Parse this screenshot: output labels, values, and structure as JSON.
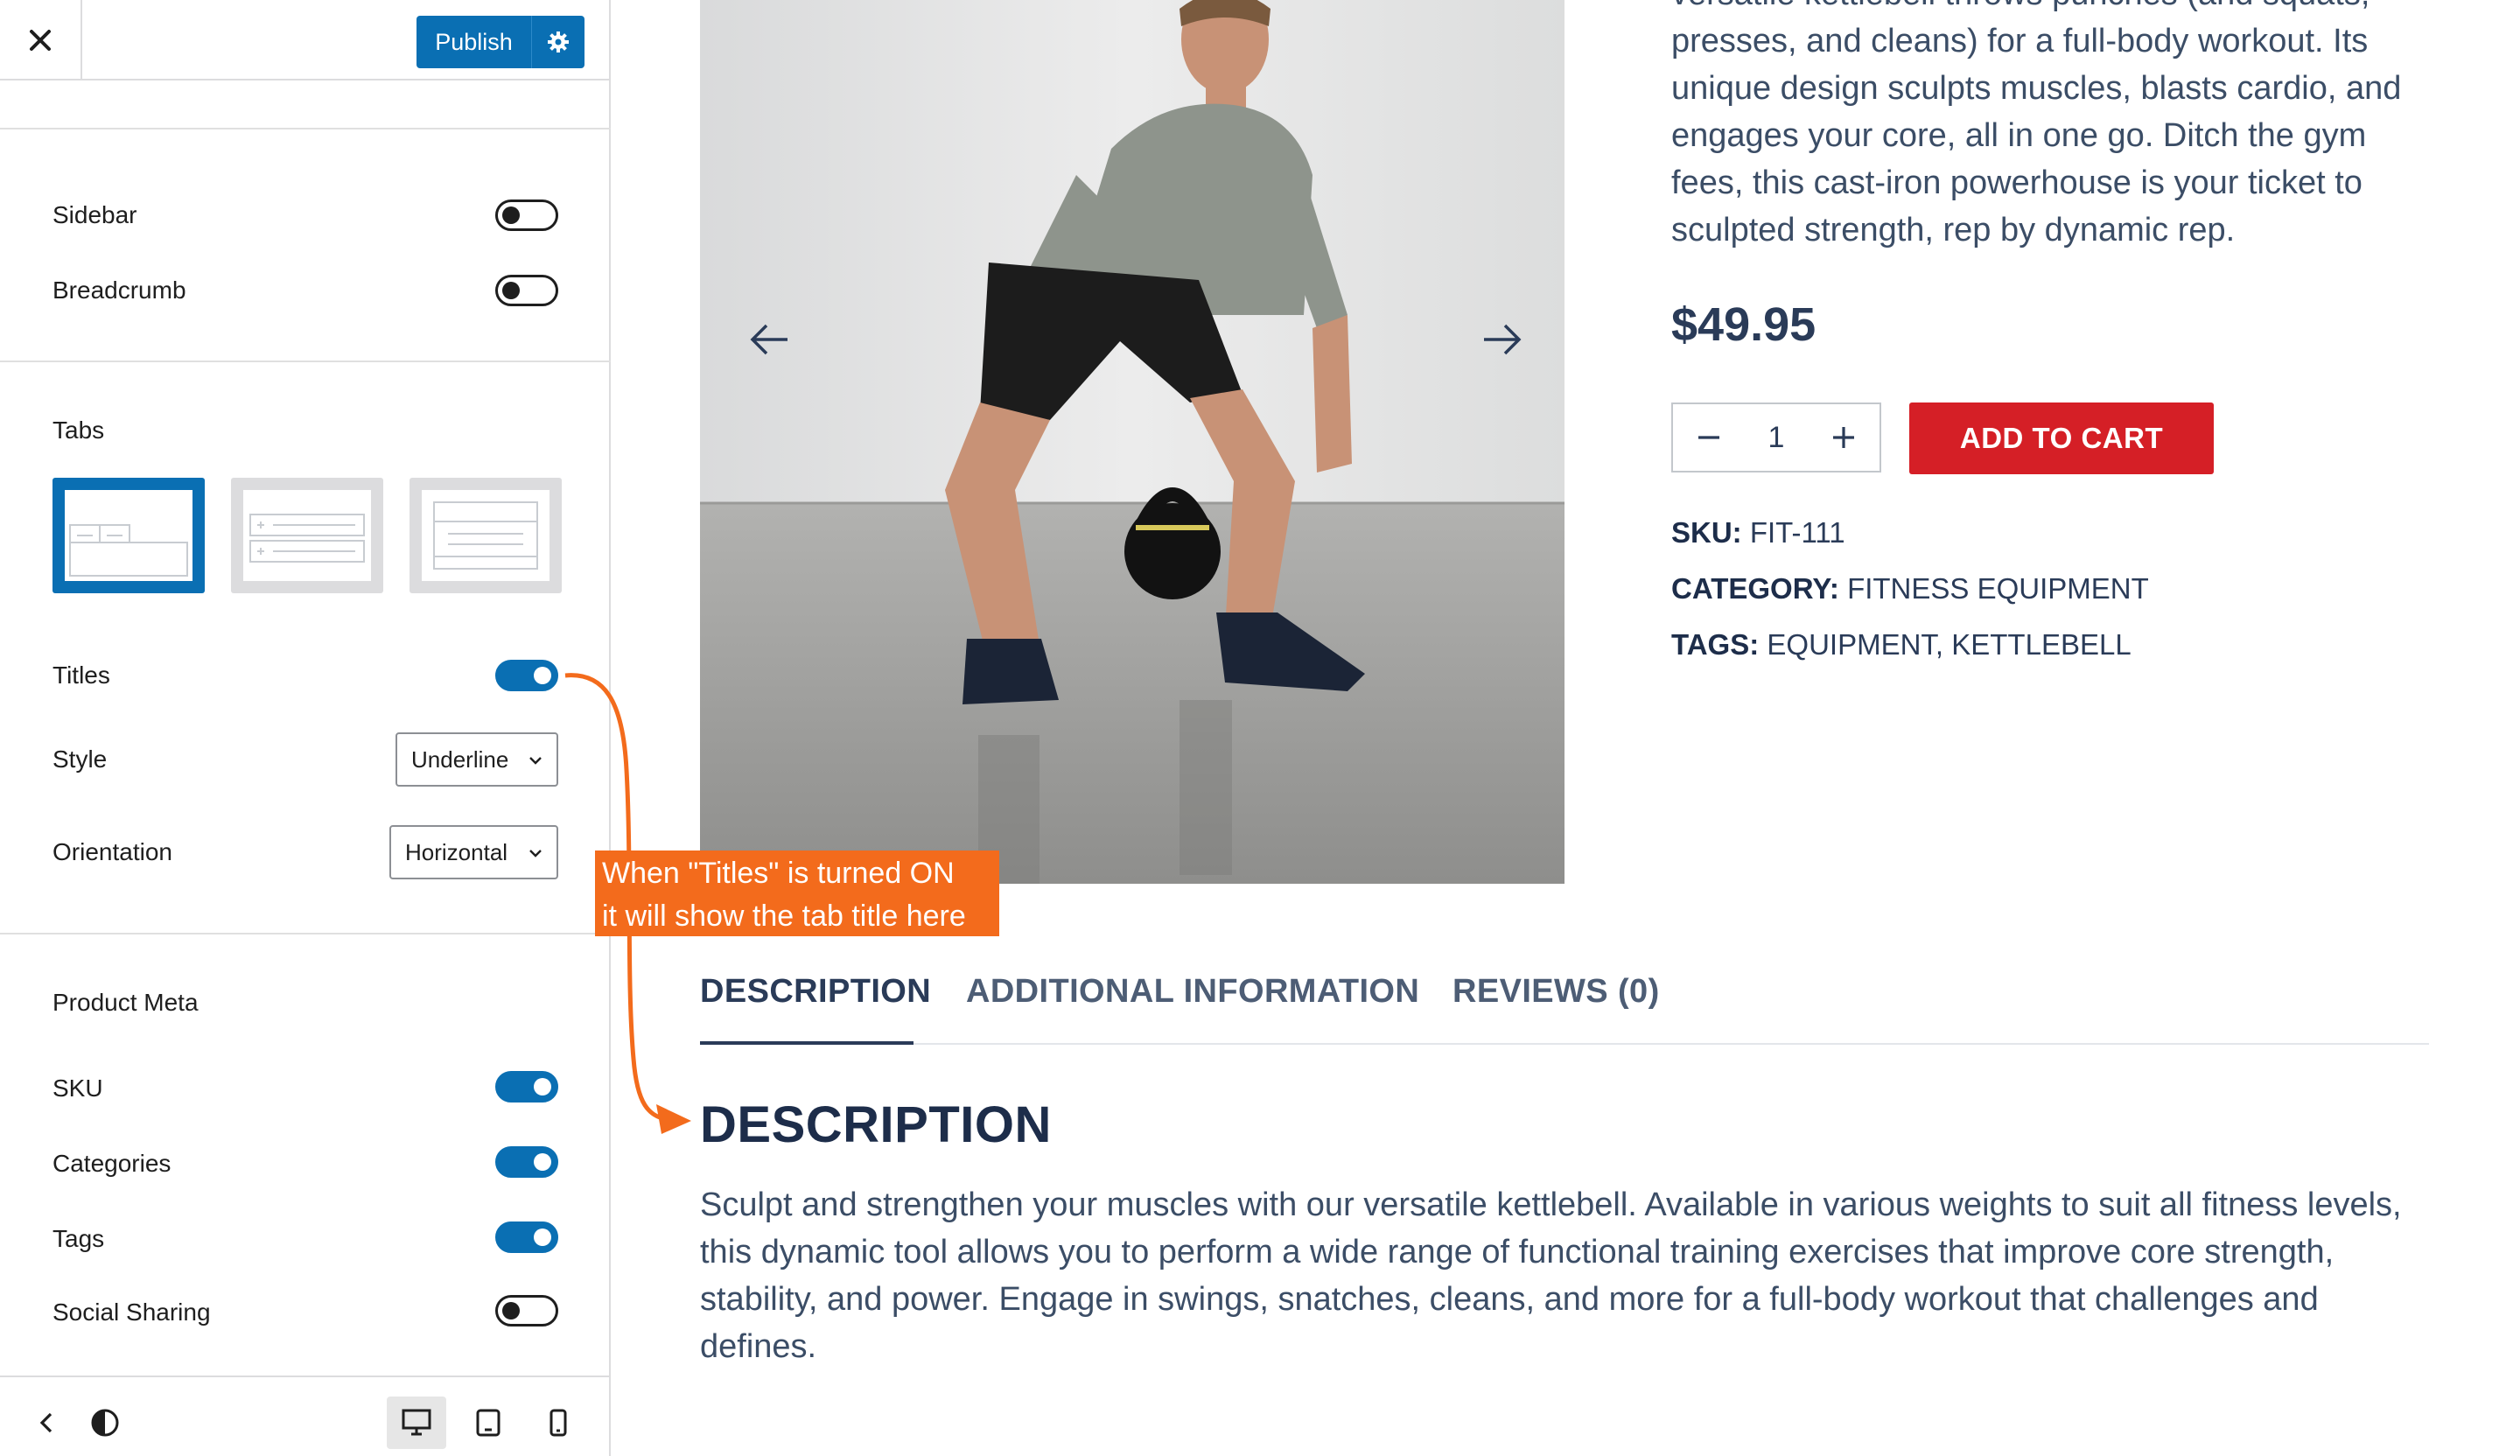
{
  "sidebar": {
    "publish_label": "Publish",
    "rows": {
      "sidebar_label": "Sidebar",
      "breadcrumb_label": "Breadcrumb",
      "titles_label": "Titles",
      "style_label": "Style",
      "orientation_label": "Orientation",
      "sku_label": "SKU",
      "categories_label": "Categories",
      "tags_label": "Tags",
      "social_label": "Social Sharing"
    },
    "toggles": {
      "sidebar": false,
      "breadcrumb": false,
      "titles": true,
      "sku": true,
      "categories": true,
      "tags": true,
      "social_sharing": false
    },
    "sections": {
      "tabs_title": "Tabs",
      "product_meta_title": "Product Meta"
    },
    "style_value": "Underline",
    "orientation_value": "Horizontal",
    "tab_layouts": [
      "horizontal",
      "accordion",
      "list"
    ],
    "selected_layout": "horizontal",
    "bottom_icons": [
      "chevron-left-icon",
      "contrast-icon",
      "desktop-icon",
      "tablet-icon",
      "mobile-icon"
    ],
    "active_device": "desktop"
  },
  "product": {
    "short_description": "versatile kettlebell throws punches (and squats, presses, and cleans) for a full-body workout. Its unique design sculpts muscles, blasts cardio, and engages your core, all in one go. Ditch the gym fees, this cast-iron powerhouse is your ticket to sculpted strength, rep by dynamic rep.",
    "price": "$49.95",
    "quantity": "1",
    "add_to_cart": "ADD TO CART",
    "meta": {
      "sku_label": "SKU:",
      "sku_value": "FIT-111",
      "category_label": "CATEGORY:",
      "category_value": "FITNESS EQUIPMENT",
      "tags_label": "TAGS:",
      "tags_value": "EQUIPMENT, KETTLEBELL"
    },
    "tabs": [
      "DESCRIPTION",
      "ADDITIONAL INFORMATION",
      "REVIEWS (0)"
    ],
    "active_tab": "DESCRIPTION",
    "description_heading": "DESCRIPTION",
    "description_body": "Sculpt and strengthen your muscles with our versatile kettlebell. Available in various weights to suit all fitness levels, this dynamic tool allows you to perform a wide range of functional training exercises that improve core strength, stability, and power. Engage in swings, snatches, cleans, and more for a full-body workout that challenges and defines."
  },
  "annotation": {
    "line1": "When \"Titles\" is turned ON",
    "line2": "it will show the tab title here"
  },
  "colors": {
    "accent": "#0a6fb3",
    "cart_red": "#d51f26",
    "annotation_orange": "#f36b1c",
    "heading_navy": "#1d2d4a"
  }
}
